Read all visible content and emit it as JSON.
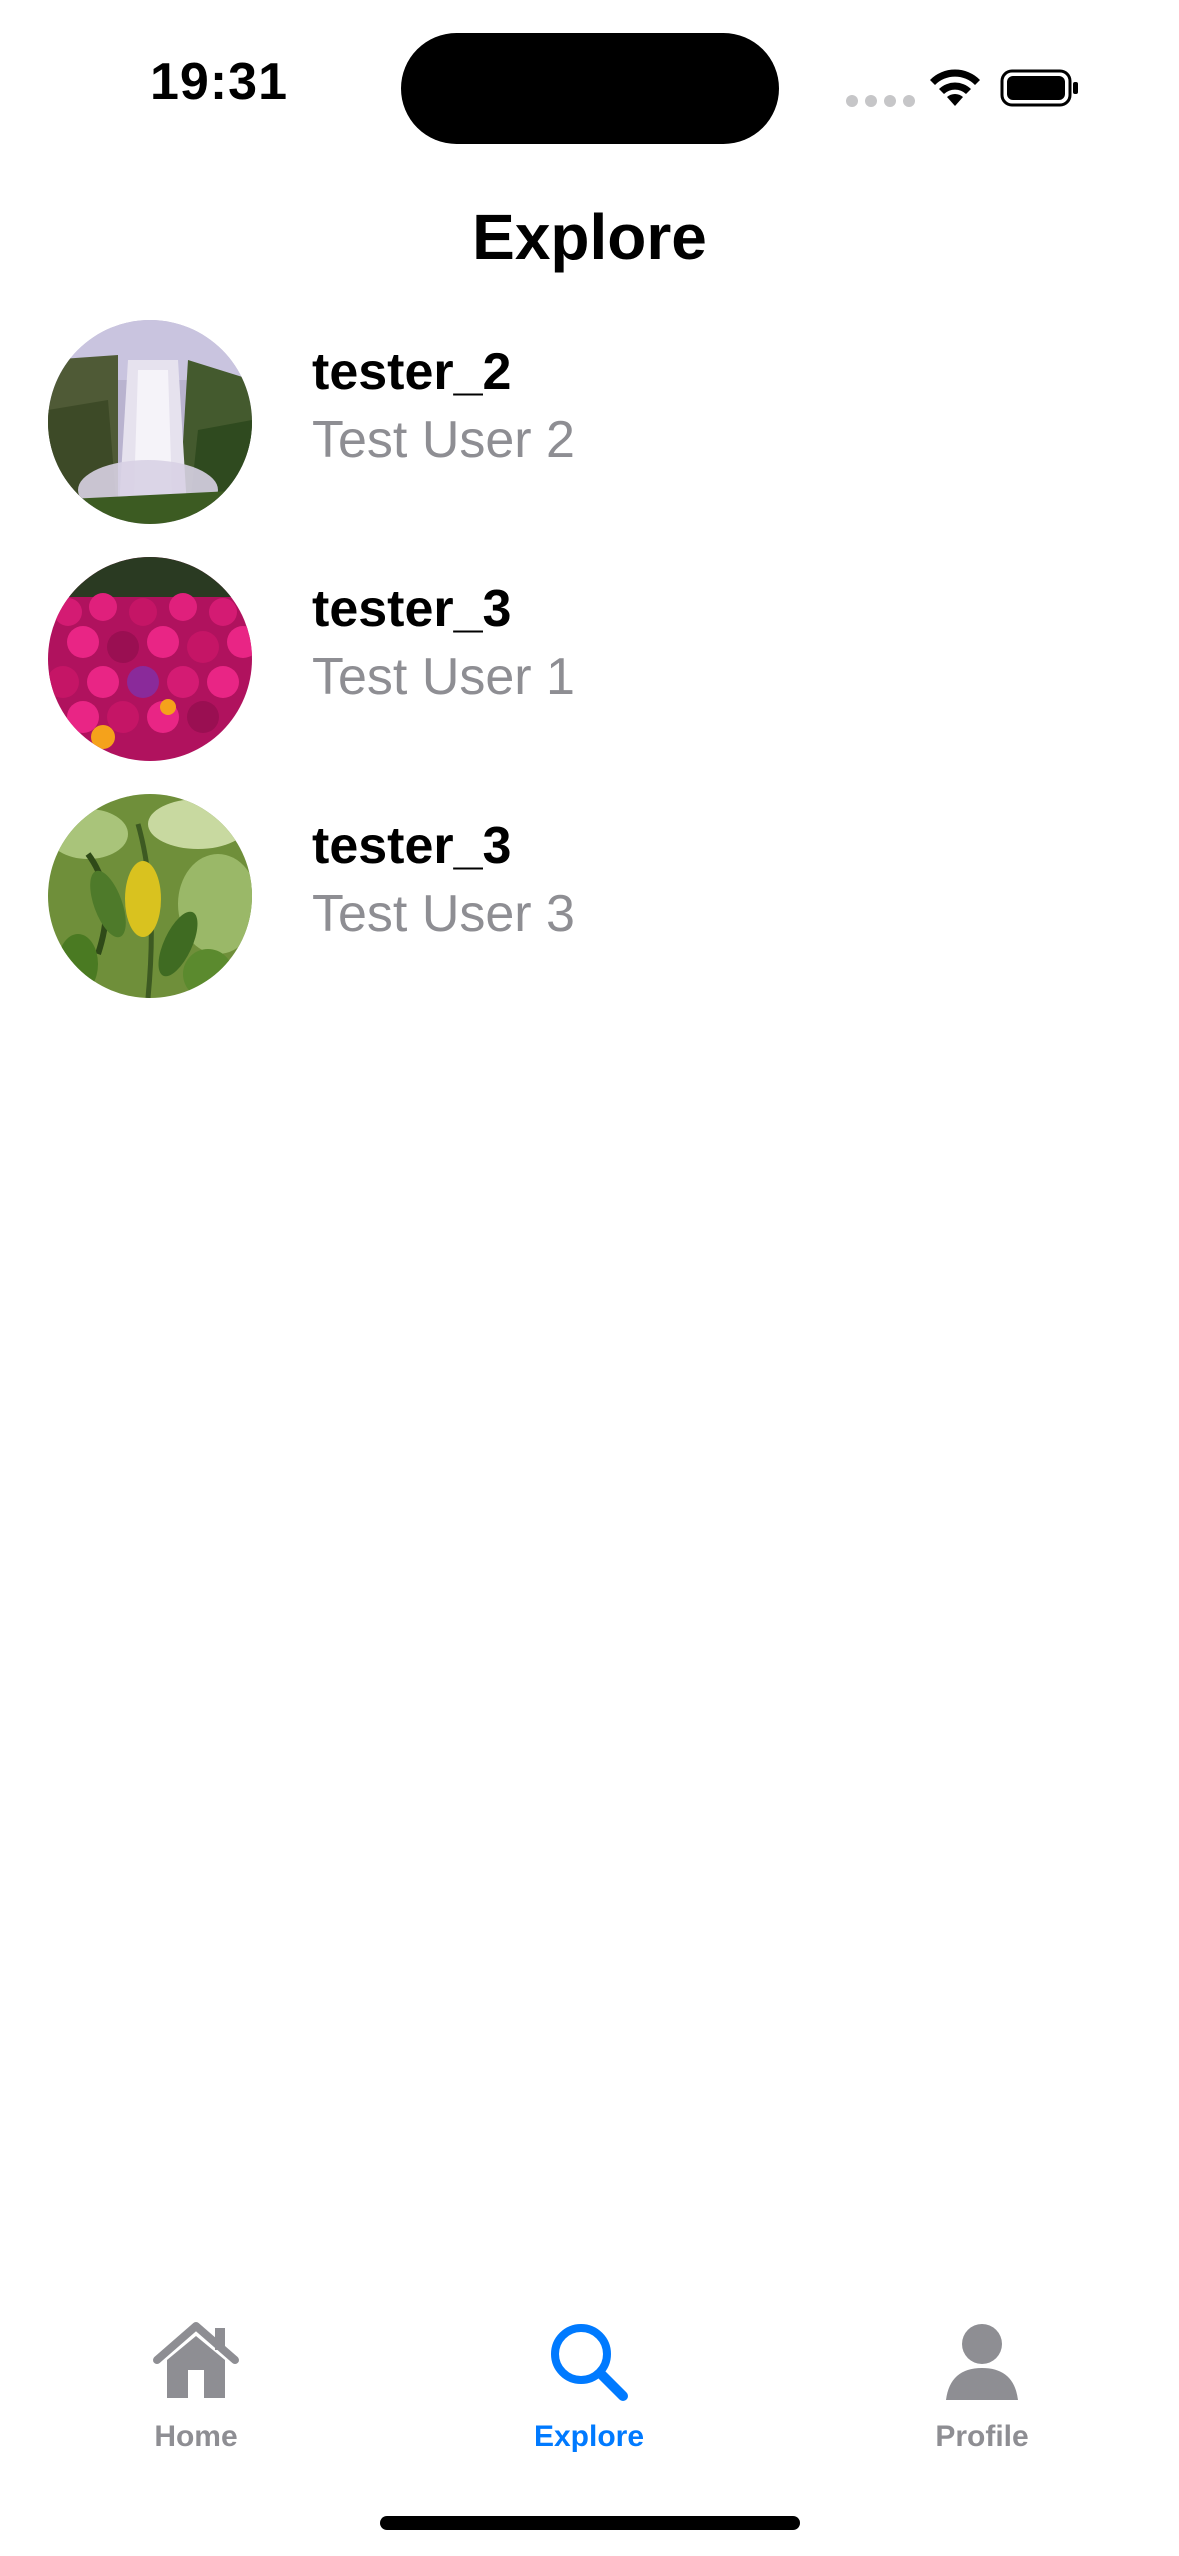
{
  "status_bar": {
    "time": "19:31"
  },
  "header": {
    "title": "Explore"
  },
  "users": [
    {
      "username": "tester_2",
      "name": "Test User 2",
      "avatar": "waterfall-photo"
    },
    {
      "username": "tester_3",
      "name": "Test User 1",
      "avatar": "flowers-photo"
    },
    {
      "username": "tester_3",
      "name": "Test User 3",
      "avatar": "leaves-photo"
    }
  ],
  "tab_bar": {
    "tabs": [
      {
        "label": "Home",
        "icon": "house-icon",
        "selected": false
      },
      {
        "label": "Explore",
        "icon": "search-icon",
        "selected": true
      },
      {
        "label": "Profile",
        "icon": "person-icon",
        "selected": false
      }
    ]
  },
  "colors": {
    "accent": "#007aff",
    "inactive": "#8e8e93",
    "secondary_text": "#8e8e93"
  }
}
